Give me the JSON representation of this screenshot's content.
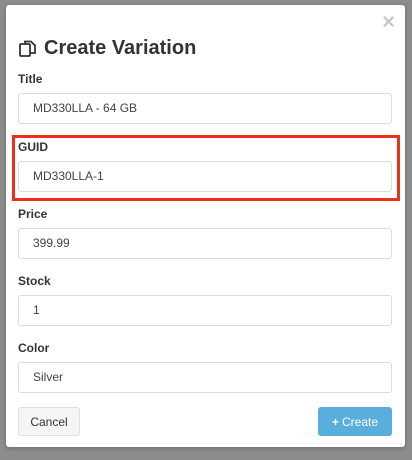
{
  "modal": {
    "title": "Create Variation",
    "title_icon": "copy-icon",
    "close_glyph": "×"
  },
  "fields": {
    "title": {
      "label": "Title",
      "value": "MD330LLA - 64 GB"
    },
    "guid": {
      "label": "GUID",
      "value": "MD330LLA-1"
    },
    "price": {
      "label": "Price",
      "value": "399.99"
    },
    "stock": {
      "label": "Stock",
      "value": "1"
    },
    "color": {
      "label": "Color",
      "value": "Silver"
    }
  },
  "buttons": {
    "cancel": "Cancel",
    "create_plus": "+",
    "create": "Create"
  },
  "colors": {
    "highlight": "#e8321a",
    "create_button": "#5aaedb"
  }
}
